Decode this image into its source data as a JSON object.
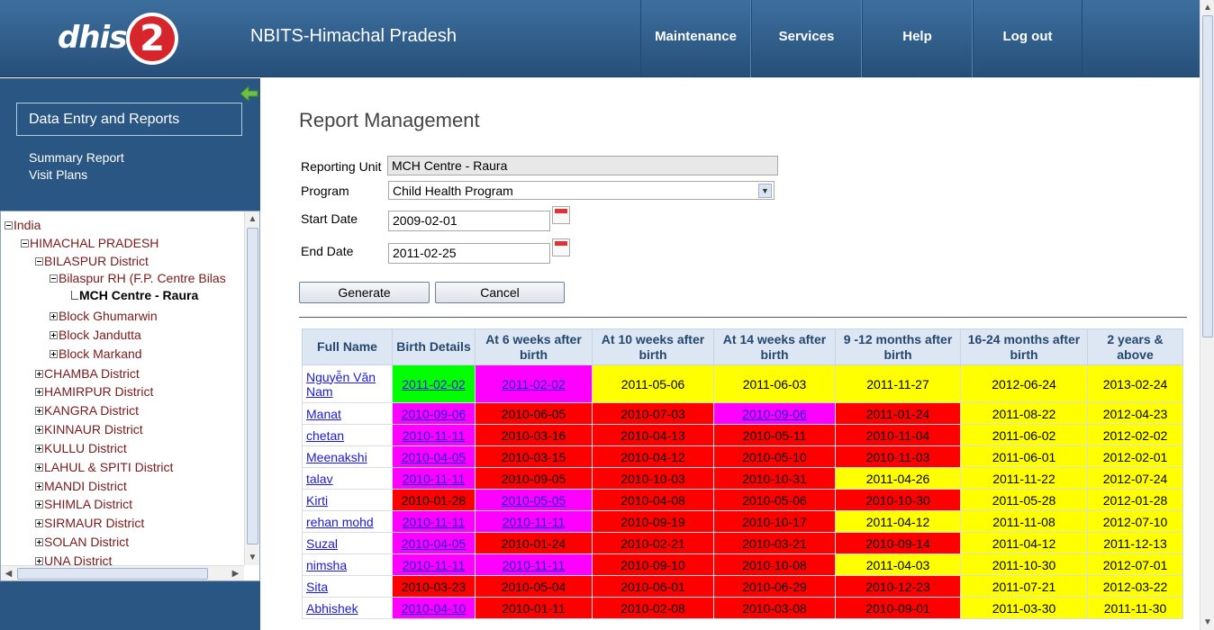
{
  "app": {
    "logo_text": "dhis2",
    "site_title": "NBITS-Himachal Pradesh",
    "nav": [
      "Maintenance",
      "Services",
      "Help",
      "Log out"
    ]
  },
  "sidebar": {
    "section_button": "Data Entry and Reports",
    "links": [
      "Summary Report",
      "Visit Plans"
    ],
    "tree": [
      {
        "label": "India",
        "toggle": "minus",
        "level": 0
      },
      {
        "label": "HIMACHAL PRADESH",
        "toggle": "minus",
        "level": 1
      },
      {
        "label": "BILASPUR District",
        "toggle": "minus",
        "level": 2
      },
      {
        "label": "Bilaspur RH (F.P. Centre Bilas",
        "toggle": "minus",
        "level": 3
      },
      {
        "label": "MCH Centre - Raura",
        "toggle": "none",
        "level": 4,
        "selected": true
      },
      {
        "label": "Block Ghumarwin",
        "toggle": "plus",
        "level": 3
      },
      {
        "label": "Block Jandutta",
        "toggle": "plus",
        "level": 3
      },
      {
        "label": "Block Markand",
        "toggle": "plus",
        "level": 3
      },
      {
        "label": "CHAMBA District",
        "toggle": "plus",
        "level": 2
      },
      {
        "label": "HAMIRPUR District",
        "toggle": "plus",
        "level": 2
      },
      {
        "label": "KANGRA District",
        "toggle": "plus",
        "level": 2
      },
      {
        "label": "KINNAUR District",
        "toggle": "plus",
        "level": 2
      },
      {
        "label": "KULLU District",
        "toggle": "plus",
        "level": 2
      },
      {
        "label": "LAHUL & SPITI District",
        "toggle": "plus",
        "level": 2
      },
      {
        "label": "MANDI District",
        "toggle": "plus",
        "level": 2
      },
      {
        "label": "SHIMLA District",
        "toggle": "plus",
        "level": 2
      },
      {
        "label": "SIRMAUR District",
        "toggle": "plus",
        "level": 2
      },
      {
        "label": "SOLAN District",
        "toggle": "plus",
        "level": 2
      },
      {
        "label": "UNA District",
        "toggle": "plus",
        "level": 2
      }
    ]
  },
  "main": {
    "title": "Report Management",
    "form": {
      "reporting_unit_label": "Reporting Unit",
      "reporting_unit_value": "MCH Centre - Raura",
      "program_label": "Program",
      "program_value": "Child Health Program",
      "start_date_label": "Start Date",
      "start_date_value": "2009-02-01",
      "end_date_label": "End Date",
      "end_date_value": "2011-02-25"
    },
    "buttons": {
      "generate": "Generate",
      "cancel": "Cancel"
    },
    "colors": {
      "green": "#00ff00",
      "magenta": "#ff00ff",
      "yellow": "#ffff00",
      "red": "#ff0000"
    },
    "table": {
      "headers": [
        "Full Name",
        "Birth Details",
        "At 6 weeks after birth",
        "At 10 weeks after birth",
        "At 14 weeks after birth",
        "9 -12 months after birth",
        "16-24 months after birth",
        "2 years & above"
      ],
      "rows": [
        {
          "name": "Nguyễn Văn Nam",
          "cells": [
            [
              "2011-02-02",
              "g",
              1
            ],
            [
              "2011-02-02",
              "m",
              1
            ],
            [
              "2011-05-06",
              "y",
              0
            ],
            [
              "2011-06-03",
              "y",
              0
            ],
            [
              "2011-11-27",
              "y",
              0
            ],
            [
              "2012-06-24",
              "y",
              0
            ],
            [
              "2013-02-24",
              "y",
              0
            ]
          ]
        },
        {
          "name": "Manat",
          "cells": [
            [
              "2010-09-06",
              "m",
              1
            ],
            [
              "2010-06-05",
              "r",
              0
            ],
            [
              "2010-07-03",
              "r",
              0
            ],
            [
              "2010-09-06",
              "m",
              1
            ],
            [
              "2011-01-24",
              "r",
              0
            ],
            [
              "2011-08-22",
              "y",
              0
            ],
            [
              "2012-04-23",
              "y",
              0
            ]
          ]
        },
        {
          "name": "chetan",
          "cells": [
            [
              "2010-11-11",
              "m",
              1
            ],
            [
              "2010-03-16",
              "r",
              0
            ],
            [
              "2010-04-13",
              "r",
              0
            ],
            [
              "2010-05-11",
              "r",
              0
            ],
            [
              "2010-11-04",
              "r",
              0
            ],
            [
              "2011-06-02",
              "y",
              0
            ],
            [
              "2012-02-02",
              "y",
              0
            ]
          ]
        },
        {
          "name": "Meenakshi",
          "cells": [
            [
              "2010-04-05",
              "m",
              1
            ],
            [
              "2010-03-15",
              "r",
              0
            ],
            [
              "2010-04-12",
              "r",
              0
            ],
            [
              "2010-05-10",
              "r",
              0
            ],
            [
              "2010-11-03",
              "r",
              0
            ],
            [
              "2011-06-01",
              "y",
              0
            ],
            [
              "2012-02-01",
              "y",
              0
            ]
          ]
        },
        {
          "name": "talav",
          "cells": [
            [
              "2010-11-11",
              "m",
              1
            ],
            [
              "2010-09-05",
              "r",
              0
            ],
            [
              "2010-10-03",
              "r",
              0
            ],
            [
              "2010-10-31",
              "r",
              0
            ],
            [
              "2011-04-26",
              "y",
              0
            ],
            [
              "2011-11-22",
              "y",
              0
            ],
            [
              "2012-07-24",
              "y",
              0
            ]
          ]
        },
        {
          "name": "Kirti",
          "cells": [
            [
              "2010-01-28",
              "r",
              0
            ],
            [
              "2010-05-05",
              "m",
              1
            ],
            [
              "2010-04-08",
              "r",
              0
            ],
            [
              "2010-05-06",
              "r",
              0
            ],
            [
              "2010-10-30",
              "r",
              0
            ],
            [
              "2011-05-28",
              "y",
              0
            ],
            [
              "2012-01-28",
              "y",
              0
            ]
          ]
        },
        {
          "name": "rehan mohd",
          "cells": [
            [
              "2010-11-11",
              "m",
              1
            ],
            [
              "2010-11-11",
              "m",
              1
            ],
            [
              "2010-09-19",
              "r",
              0
            ],
            [
              "2010-10-17",
              "r",
              0
            ],
            [
              "2011-04-12",
              "y",
              0
            ],
            [
              "2011-11-08",
              "y",
              0
            ],
            [
              "2012-07-10",
              "y",
              0
            ]
          ]
        },
        {
          "name": "Suzal",
          "cells": [
            [
              "2010-04-05",
              "m",
              1
            ],
            [
              "2010-01-24",
              "r",
              0
            ],
            [
              "2010-02-21",
              "r",
              0
            ],
            [
              "2010-03-21",
              "r",
              0
            ],
            [
              "2010-09-14",
              "r",
              0
            ],
            [
              "2011-04-12",
              "y",
              0
            ],
            [
              "2011-12-13",
              "y",
              0
            ]
          ]
        },
        {
          "name": "nimsha",
          "cells": [
            [
              "2010-11-11",
              "m",
              1
            ],
            [
              "2010-11-11",
              "m",
              1
            ],
            [
              "2010-09-10",
              "r",
              0
            ],
            [
              "2010-10-08",
              "r",
              0
            ],
            [
              "2011-04-03",
              "y",
              0
            ],
            [
              "2011-10-30",
              "y",
              0
            ],
            [
              "2012-07-01",
              "y",
              0
            ]
          ]
        },
        {
          "name": "Sita",
          "cells": [
            [
              "2010-03-23",
              "r",
              0
            ],
            [
              "2010-05-04",
              "r",
              0
            ],
            [
              "2010-06-01",
              "r",
              0
            ],
            [
              "2010-06-29",
              "r",
              0
            ],
            [
              "2010-12-23",
              "r",
              0
            ],
            [
              "2011-07-21",
              "y",
              0
            ],
            [
              "2012-03-22",
              "y",
              0
            ]
          ]
        },
        {
          "name": "Abhishek",
          "cells": [
            [
              "2010-04-10",
              "m",
              1
            ],
            [
              "2010-01-11",
              "r",
              0
            ],
            [
              "2010-02-08",
              "r",
              0
            ],
            [
              "2010-03-08",
              "r",
              0
            ],
            [
              "2010-09-01",
              "r",
              0
            ],
            [
              "2011-03-30",
              "y",
              0
            ],
            [
              "2011-11-30",
              "y",
              0
            ]
          ]
        }
      ]
    }
  }
}
